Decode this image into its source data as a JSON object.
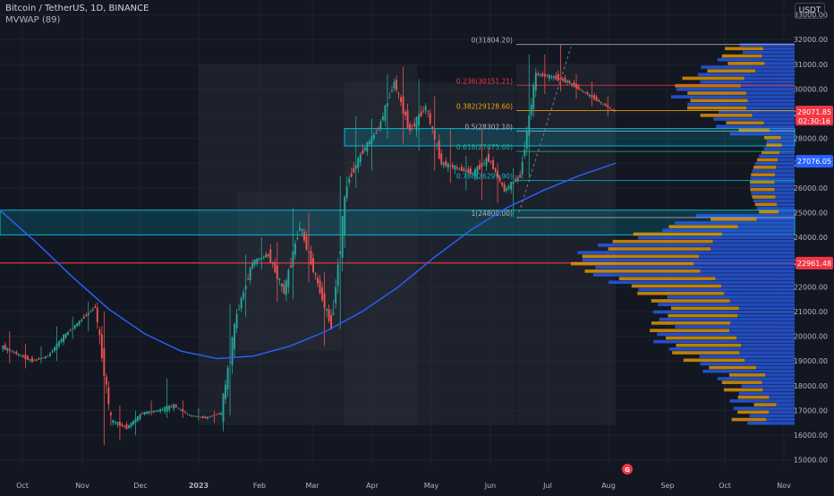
{
  "header": {
    "title": "Bitcoin / TetherUS, 1D, BINANCE",
    "indicator": "MVWAP (89)",
    "currency": "USDT"
  },
  "colors": {
    "background": "#131722",
    "up": "#26a69a",
    "down": "#ef5350",
    "mvwap": "#2962ff",
    "fib_red": "#f23645",
    "fib_orange": "#f7a600",
    "fib_teal": "#22ab94",
    "zone_cyan": "#00bcd4",
    "volume_profile_blue": "#2962ff",
    "volume_profile_orange": "#f7a600"
  },
  "price_tags": {
    "last_price": "29071.85",
    "countdown": "02:30:16",
    "mvwap_price": "27076.05",
    "red_line_price": "22961.48"
  },
  "fib_levels": [
    {
      "label": "0(31804.20)",
      "price": 31804.2,
      "color": "#b2b5be"
    },
    {
      "label": "0.236(30151.21)",
      "price": 30151.21,
      "color": "#f23645"
    },
    {
      "label": "0.382(29128.60)",
      "price": 29128.6,
      "color": "#f7a600"
    },
    {
      "label": "0.5(28302.10)",
      "price": 28302.1,
      "color": "#b2b5be"
    },
    {
      "label": "0.618(27475.60)",
      "price": 27475.6,
      "color": "#22ab94"
    },
    {
      "label": "0.786(26299.90)",
      "price": 26299.9,
      "color": "#00bcd4"
    },
    {
      "label": "1(24800.00)",
      "price": 24800.0,
      "color": "#b2b5be"
    }
  ],
  "bottom_badge": "G",
  "chart_data": {
    "type": "candlestick",
    "title": "Bitcoin / TetherUS, 1D, BINANCE",
    "ylim": [
      14700,
      33600
    ],
    "y_ticks": [
      15000,
      16000,
      17000,
      18000,
      19000,
      20000,
      21000,
      22000,
      23000,
      24000,
      25000,
      26000,
      27000,
      28000,
      29000,
      30000,
      31000,
      32000,
      33000
    ],
    "x_ticks": [
      "Oct",
      "Nov",
      "Dec",
      "2023",
      "Feb",
      "Mar",
      "Apr",
      "May",
      "Jun",
      "Jul",
      "Aug",
      "Sep",
      "Oct",
      "Nov"
    ],
    "grid": true,
    "candles_weekly_approx": [
      [
        19600,
        20200,
        18900,
        19300
      ],
      [
        19300,
        19700,
        18700,
        19000
      ],
      [
        19000,
        19600,
        18900,
        19200
      ],
      [
        19200,
        20400,
        19000,
        20000
      ],
      [
        20000,
        20800,
        19900,
        20600
      ],
      [
        20600,
        21400,
        20200,
        21200
      ],
      [
        21200,
        21000,
        15600,
        16600
      ],
      [
        16600,
        17200,
        15800,
        16300
      ],
      [
        16300,
        17000,
        16000,
        16900
      ],
      [
        16900,
        17400,
        16800,
        17000
      ],
      [
        17000,
        18300,
        16700,
        17200
      ],
      [
        17200,
        17400,
        16700,
        16800
      ],
      [
        16800,
        17100,
        16600,
        16700
      ],
      [
        16700,
        17000,
        16500,
        16900
      ],
      [
        16900,
        21300,
        16800,
        20900
      ],
      [
        20900,
        23300,
        20800,
        23000
      ],
      [
        23000,
        24000,
        22700,
        23300
      ],
      [
        23300,
        23800,
        21400,
        21800
      ],
      [
        21800,
        25200,
        21500,
        24500
      ],
      [
        24500,
        25000,
        22200,
        22400
      ],
      [
        22400,
        22600,
        19600,
        20400
      ],
      [
        20400,
        26500,
        20300,
        26200
      ],
      [
        26200,
        28900,
        26000,
        27500
      ],
      [
        27500,
        28800,
        26700,
        28400
      ],
      [
        28400,
        30600,
        28000,
        30300
      ],
      [
        30300,
        30900,
        27800,
        28300
      ],
      [
        28300,
        30400,
        27500,
        29300
      ],
      [
        29300,
        29700,
        26700,
        27000
      ],
      [
        27000,
        28400,
        26200,
        26800
      ],
      [
        26800,
        27300,
        25900,
        26600
      ],
      [
        26600,
        28400,
        25500,
        27200
      ],
      [
        27200,
        27000,
        25400,
        25900
      ],
      [
        25900,
        26800,
        24800,
        26500
      ],
      [
        26500,
        31400,
        26400,
        30600
      ],
      [
        30600,
        31400,
        29800,
        30500
      ],
      [
        30500,
        31800,
        29900,
        30300
      ],
      [
        30300,
        30600,
        29600,
        29900
      ],
      [
        29900,
        30300,
        29300,
        29500
      ],
      [
        29500,
        29700,
        28900,
        29100
      ]
    ],
    "mvwap_series_approx": [
      25100,
      23800,
      22400,
      21100,
      20100,
      19400,
      19100,
      19200,
      19600,
      20200,
      21000,
      22000,
      23200,
      24300,
      25200,
      25900,
      26500,
      27000
    ],
    "zones": [
      {
        "name": "cyan-zone-upper",
        "from": 27700,
        "to": 28400
      },
      {
        "name": "cyan-zone-lower",
        "from": 24100,
        "to": 25100
      }
    ],
    "horizontal_lines": [
      {
        "name": "red-line",
        "price": 22961.48,
        "color": "#f23645"
      }
    ]
  }
}
